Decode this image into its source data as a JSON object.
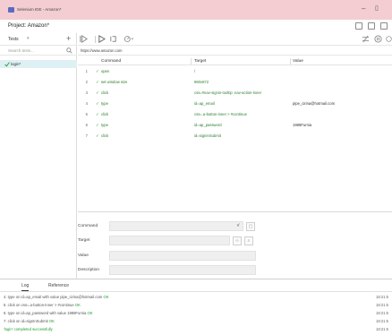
{
  "window": {
    "title": "Selenium IDE - Amazon*"
  },
  "project": {
    "label": "Project:",
    "name": "Amazon*"
  },
  "sidebar": {
    "dropdown_label": "Tests",
    "caret": "▾",
    "add": "+",
    "search_placeholder": "Search tests...",
    "tests": [
      {
        "name": "login*",
        "selected": true
      }
    ]
  },
  "url": {
    "value": "https://www.amazon.com"
  },
  "table": {
    "headers": {
      "command": "Command",
      "target": "Target",
      "value": "Value"
    },
    "rows": [
      {
        "num": "1",
        "command": "open",
        "target": "/",
        "value": ""
      },
      {
        "num": "2",
        "command": "set window size",
        "target": "960x872",
        "value": ""
      },
      {
        "num": "3",
        "command": "click",
        "target": "css=#nav-signin-tooltip .nav-action-inner",
        "value": ""
      },
      {
        "num": "4",
        "command": "type",
        "target": "id=ap_email",
        "value": "pipe_cirina@hotmail.com"
      },
      {
        "num": "5",
        "command": "click",
        "target": "css=.a-button-inner > #continue",
        "value": ""
      },
      {
        "num": "6",
        "command": "type",
        "target": "id=ap_password",
        "value": "1989Furnia"
      },
      {
        "num": "7",
        "command": "click",
        "target": "id=signInSubmit",
        "value": ""
      }
    ]
  },
  "command_panel": {
    "labels": {
      "command": "Command",
      "target": "Target",
      "value": "Value",
      "description": "Description"
    }
  },
  "log": {
    "tabs": [
      "Log",
      "Reference"
    ],
    "entries": [
      {
        "text": "4.  type on id=ap_email with value pipe_cirina@hotmail.com",
        "ok": "OK",
        "time": "18:21:5"
      },
      {
        "text": "5.  click on css=.a-button-inner > #continue",
        "ok": "OK",
        "time": "18:21:5"
      },
      {
        "text": "6.  type on id=ap_password with value 1989Furnia",
        "ok": "OK",
        "time": "18:21:5"
      },
      {
        "text": "7.  click on id=signInSubmit",
        "ok": "OK",
        "time": "18:21:5"
      },
      {
        "text": "'login' completed successfully",
        "ok": "",
        "time": "18:21:5",
        "success": true
      }
    ]
  },
  "colors": {
    "titlebar_bg": "#f3cdd2",
    "success_green": "#1e9e2f",
    "command_green": "#2a7a2a",
    "selected_row": "#dff0f4"
  },
  "icons": {
    "app": "selenium-icon",
    "run_all": "run-all-tests-icon",
    "run": "run-current-test-icon",
    "step": "step-over-icon",
    "speed": "test-speed-icon",
    "disable_breakpoints": "disable-breakpoints-icon",
    "pause_exceptions": "pause-on-exceptions-icon",
    "record": "record-icon",
    "new_project": "new-project-icon",
    "open_project": "open-project-icon",
    "save_project": "save-project-icon"
  }
}
